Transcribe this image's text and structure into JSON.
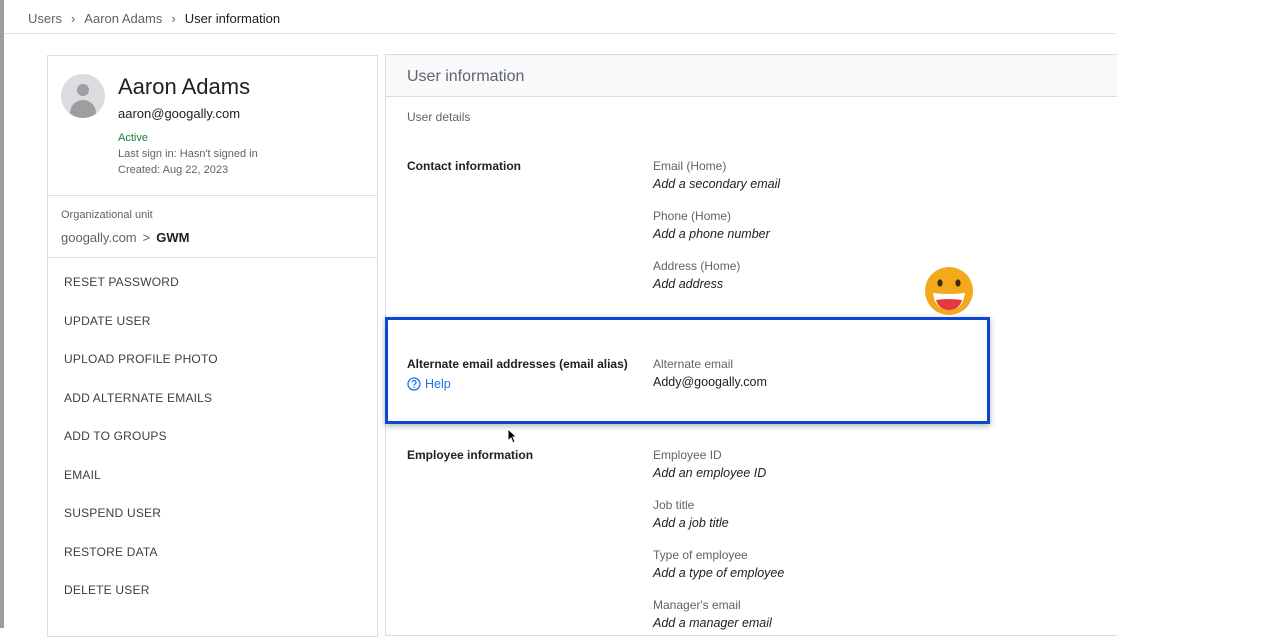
{
  "breadcrumb": {
    "items": [
      "Users",
      "Aaron Adams"
    ],
    "current": "User information"
  },
  "profile": {
    "name": "Aaron Adams",
    "email": "aaron@googally.com",
    "status": "Active",
    "last_sign_in": "Last sign in: Hasn't signed in",
    "created": "Created: Aug 22, 2023",
    "org_unit_label": "Organizational unit",
    "org_unit_parent": "googally.com",
    "org_unit_separator": ">",
    "org_unit_child": "GWM"
  },
  "actions": [
    "RESET PASSWORD",
    "UPDATE USER",
    "UPLOAD PROFILE PHOTO",
    "ADD ALTERNATE EMAILS",
    "ADD TO GROUPS",
    "EMAIL",
    "SUSPEND USER",
    "RESTORE DATA",
    "DELETE USER"
  ],
  "panel": {
    "title": "User information",
    "subheading": "User details",
    "contact": {
      "title": "Contact information",
      "email_label": "Email (Home)",
      "email_value": "Add a secondary email",
      "phone_label": "Phone (Home)",
      "phone_value": "Add a phone number",
      "address_label": "Address (Home)",
      "address_value": "Add address"
    },
    "alias": {
      "title": "Alternate email addresses (email alias)",
      "help": "Help",
      "label": "Alternate email",
      "value": "Addy@googally.com"
    },
    "employee": {
      "title": "Employee information",
      "id_label": "Employee ID",
      "id_value": "Add an employee ID",
      "job_label": "Job title",
      "job_value": "Add a job title",
      "type_label": "Type of employee",
      "type_value": "Add a type of employee",
      "manager_label": "Manager's email",
      "manager_value": "Add a manager email"
    }
  },
  "colors": {
    "status_active": "#188038",
    "link": "#1a73e8",
    "highlight_border": "#0b46d6",
    "emoji_face": "#f4a81c"
  },
  "icons": [
    "avatar-placeholder-icon",
    "chevron-right-icon",
    "help-circle-icon",
    "grinning-emoji-icon",
    "mouse-cursor-icon"
  ]
}
